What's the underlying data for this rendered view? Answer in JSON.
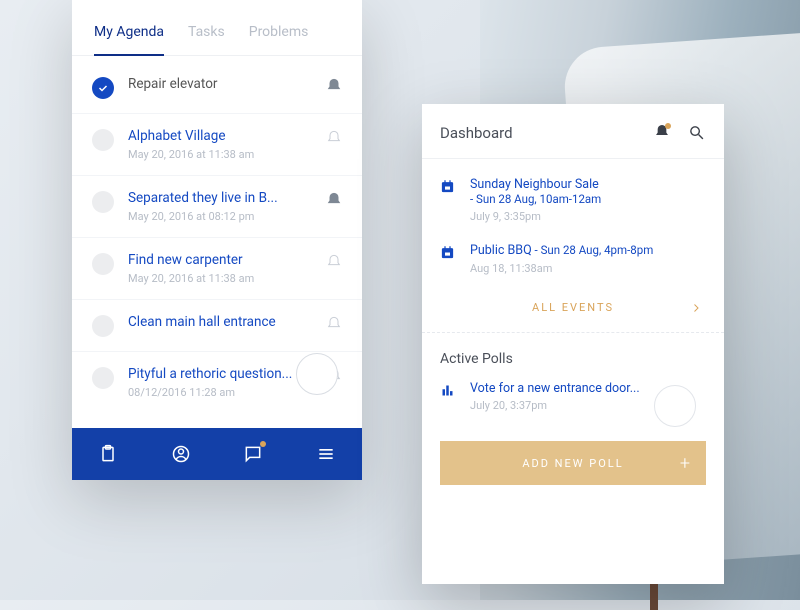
{
  "left": {
    "tabs": [
      "My Agenda",
      "Tasks",
      "Problems"
    ],
    "activeTab": 0,
    "items": [
      {
        "title": "Repair elevator",
        "time": "",
        "done": true,
        "bell": "on"
      },
      {
        "title": "Alphabet Village",
        "time": "May 20, 2016 at 11:38 am",
        "done": false,
        "bell": "off"
      },
      {
        "title": "Separated they live in B...",
        "time": "May 20, 2016 at 08:12 pm",
        "done": false,
        "bell": "on"
      },
      {
        "title": "Find new carpenter",
        "time": "May 20, 2016 at 11:38 am",
        "done": false,
        "bell": "off"
      },
      {
        "title": "Clean main hall entrance",
        "time": "",
        "done": false,
        "bell": "off"
      },
      {
        "title": "Pityful a rethoric question...",
        "time": "08/12/2016 11:28 am",
        "done": false,
        "bell": "off"
      }
    ]
  },
  "right": {
    "headerTitle": "Dashboard",
    "events": [
      {
        "title": "Sunday Neighbour Sale",
        "sub": "- Sun 28 Aug, 10am-12am",
        "posted": "July 9, 3:35pm"
      },
      {
        "title": "Public BBQ",
        "sub": " - Sun 28 Aug, 4pm-8pm",
        "posted": "Aug 18, 11:38am"
      }
    ],
    "allEventsLabel": "ALL EVENTS",
    "pollsTitle": "Active Polls",
    "poll": {
      "title": "Vote for a new entrance door...",
      "time": "July 20, 3:37pm"
    },
    "addPollLabel": "ADD NEW POLL"
  }
}
